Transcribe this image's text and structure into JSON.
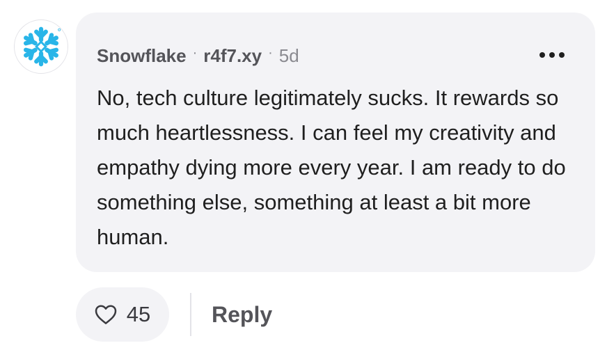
{
  "comment": {
    "author": "Snowflake",
    "separator": "·",
    "handle": "r4f7.xy",
    "age": "5d",
    "avatar_icon": "snowflake-logo-icon",
    "more_icon": "more-horizontal-icon",
    "text": "No, tech culture legitimately sucks. It rewards so much heartlessness. I can feel my creativity and empathy dying more every year. I am ready to do something else, something at least a bit more human."
  },
  "actions": {
    "like_icon": "heart-icon",
    "like_count": "45",
    "reply_label": "Reply"
  },
  "colors": {
    "bubble_bg": "#f3f3f6",
    "logo_blue": "#29b5e8",
    "text": "#1f1f1f",
    "meta_text": "#545459",
    "muted": "#8a8a90"
  }
}
